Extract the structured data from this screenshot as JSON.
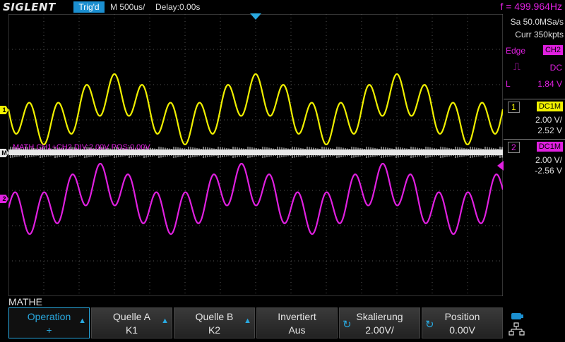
{
  "header": {
    "logo": "SIGLENT",
    "trigger_status": "Trig'd",
    "timebase": "M 500us/",
    "delay": "Delay:0.00s",
    "frequency": "f = 499.964Hz"
  },
  "acquisition": {
    "sample_rate": "Sa 50.0MSa/s",
    "memory_depth": "Curr 350kpts"
  },
  "trigger": {
    "type": "Edge",
    "source": "CH2",
    "coupling": "DC",
    "slope_symbol": "⎍",
    "level_label": "L",
    "level": "1.84 V"
  },
  "channels": [
    {
      "number": "1",
      "coupling": "DC1M",
      "scale": "2.00 V/",
      "offset": "2.52 V",
      "color": "#f0f000"
    },
    {
      "number": "2",
      "coupling": "DC1M",
      "scale": "2.00 V/",
      "offset": "-2.56 V",
      "color": "#e020e0"
    }
  ],
  "math_label": "MATH  CH1+CH2  DIV:2.00V  POS:0.00V",
  "markers": {
    "ch1": "1",
    "ch2": "2",
    "math": "M"
  },
  "menu": {
    "title": "MATHE",
    "softkeys": [
      {
        "label": "Operation",
        "value": "+",
        "active": true,
        "icon": "up-arrow-icon"
      },
      {
        "label": "Quelle A",
        "value": "K1",
        "active": false,
        "icon": "up-arrow-icon"
      },
      {
        "label": "Quelle B",
        "value": "K2",
        "active": false,
        "icon": "up-arrow-icon"
      },
      {
        "label": "Invertiert",
        "value": "Aus",
        "active": false,
        "icon": ""
      },
      {
        "label": "Skalierung",
        "value": "2.00V/",
        "active": false,
        "icon": "knob-icon"
      },
      {
        "label": "Position",
        "value": "0.00V",
        "active": false,
        "icon": "knob-icon"
      }
    ]
  },
  "colors": {
    "ch1": "#f0f000",
    "ch2": "#e020e0",
    "math": "#e8e8e8",
    "accent": "#29a9e0",
    "grid": "#555555"
  }
}
